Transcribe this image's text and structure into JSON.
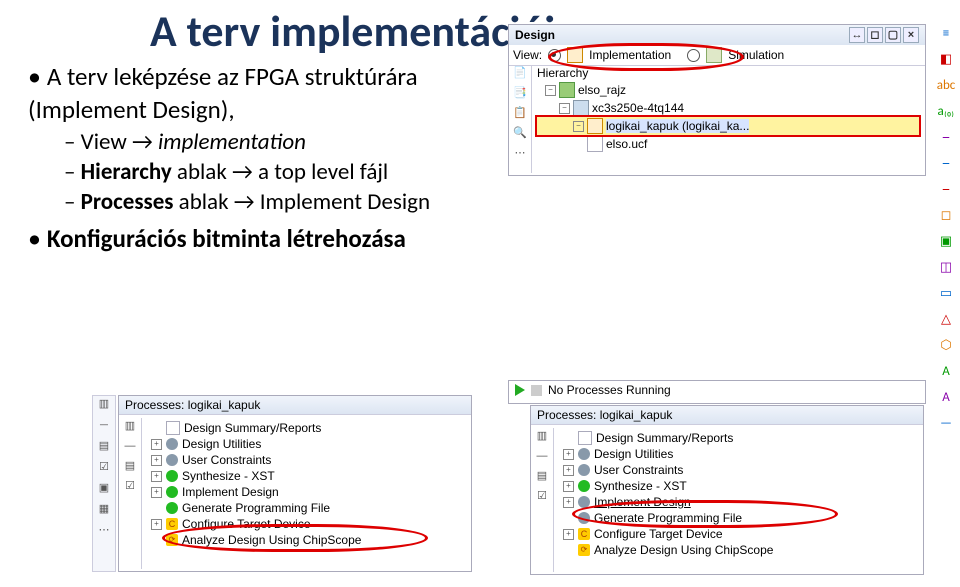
{
  "title": "A terv implementációja",
  "bullets": {
    "b1a": "A terv leképzése az FPGA struktúrára (Implement Design),",
    "b2a_prefix": "View →",
    "b2a_em": "implementation",
    "b2b_prefix": "Hierarchy ",
    "b2b_rest": "ablak → a top level fájl",
    "b2c_prefix": "Processes ",
    "b2c_rest": "ablak → Implement Design",
    "b1b": "Konfigurációs bitminta létrehozása"
  },
  "design": {
    "title": "Design",
    "view_label": "View:",
    "impl_label": "Implementation",
    "sim_label": "Simulation",
    "hierarchy_label": "Hierarchy",
    "rows": [
      {
        "name": "elso_rajz",
        "ico": "green"
      },
      {
        "name": "xc3s250e-4tq144",
        "ico": "chip"
      },
      {
        "name": "logikai_kapuk (logikai_ka...",
        "ico": "or",
        "sel": true
      },
      {
        "name": "elso.ucf",
        "ico": "doc"
      }
    ]
  },
  "noproc": "No Processes Running",
  "proc_left": {
    "title": "Processes: logikai_kapuk",
    "items": [
      {
        "label": "Design Summary/Reports",
        "box": "",
        "ico": "doc"
      },
      {
        "label": "Design Utilities",
        "box": "p",
        "ico": "gear"
      },
      {
        "label": "User Constraints",
        "box": "p",
        "ico": "gear"
      },
      {
        "label": "Synthesize - XST",
        "box": "p",
        "ico": "ok"
      },
      {
        "label": "Implement Design",
        "box": "p",
        "ico": "ok"
      },
      {
        "label": "Generate Programming File",
        "box": "",
        "ico": "ok",
        "highlight": true
      },
      {
        "label": "Configure Target Device",
        "box": "p",
        "ico": "c"
      },
      {
        "label": "Analyze Design Using ChipScope",
        "box": "",
        "ico": "cc"
      }
    ]
  },
  "proc_right": {
    "title": "Processes: logikai_kapuk",
    "items": [
      {
        "label": "Design Summary/Reports",
        "box": "",
        "ico": "doc"
      },
      {
        "label": "Design Utilities",
        "box": "p",
        "ico": "gear"
      },
      {
        "label": "User Constraints",
        "box": "p",
        "ico": "gear"
      },
      {
        "label": "Synthesize - XST",
        "box": "p",
        "ico": "ok"
      },
      {
        "label": "Implement Design",
        "box": "p",
        "ico": "gear",
        "highlight": true,
        "sel": true
      },
      {
        "label": "Generate Programming File",
        "box": "",
        "ico": "gear"
      },
      {
        "label": "Configure Target Device",
        "box": "p",
        "ico": "c"
      },
      {
        "label": "Analyze Design Using ChipScope",
        "box": "",
        "ico": "cc"
      }
    ]
  },
  "right_icons": [
    "≡",
    "◧",
    "abc",
    "a₍₀₎",
    "⎯",
    "⎯",
    "⎯",
    "◻",
    "▣",
    "◫",
    "▭",
    "△",
    "⬡",
    "A",
    "A",
    "—"
  ]
}
